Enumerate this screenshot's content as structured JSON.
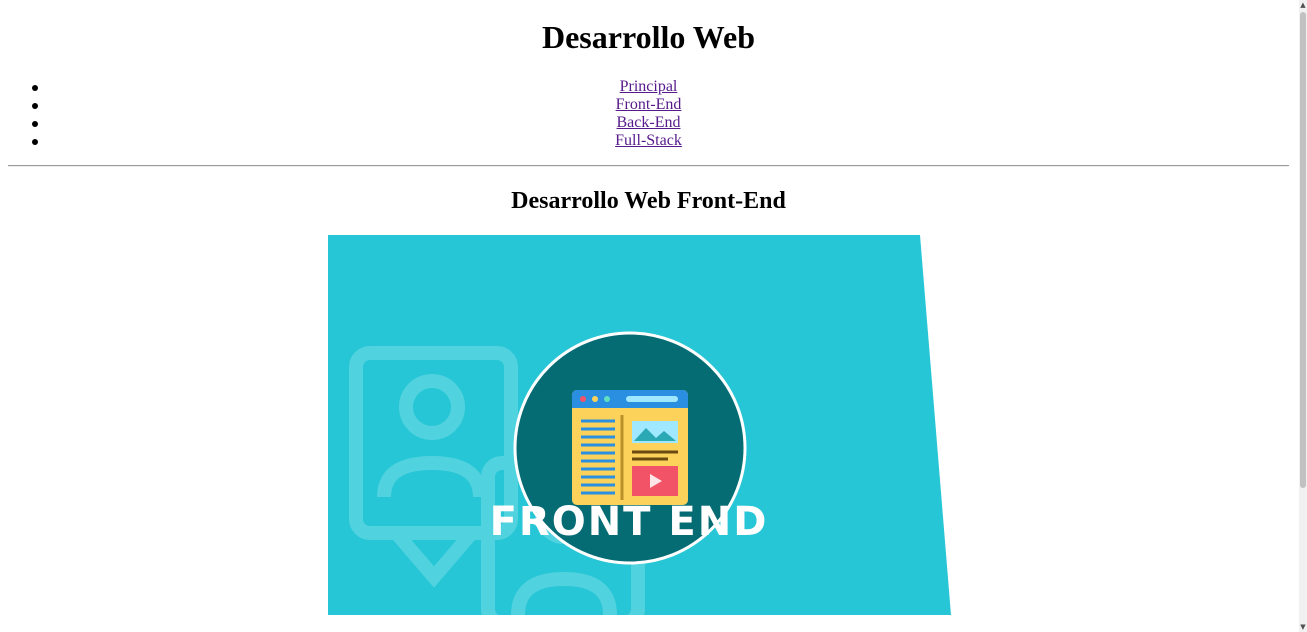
{
  "header": {
    "title": "Desarrollo Web"
  },
  "nav": {
    "items": [
      {
        "label": "Principal"
      },
      {
        "label": "Front-End"
      },
      {
        "label": "Back-End"
      },
      {
        "label": "Full-Stack"
      }
    ]
  },
  "main": {
    "section_title": "Desarrollo Web Front-End",
    "hero": {
      "banner_text": "FRONT END",
      "icon": "browser-window-icon",
      "colors": {
        "background": "#27c6d6",
        "circle": "#066c74",
        "window_body": "#fcd25a",
        "title_bar": "#2a8fe0",
        "video": "#f25366"
      }
    }
  }
}
